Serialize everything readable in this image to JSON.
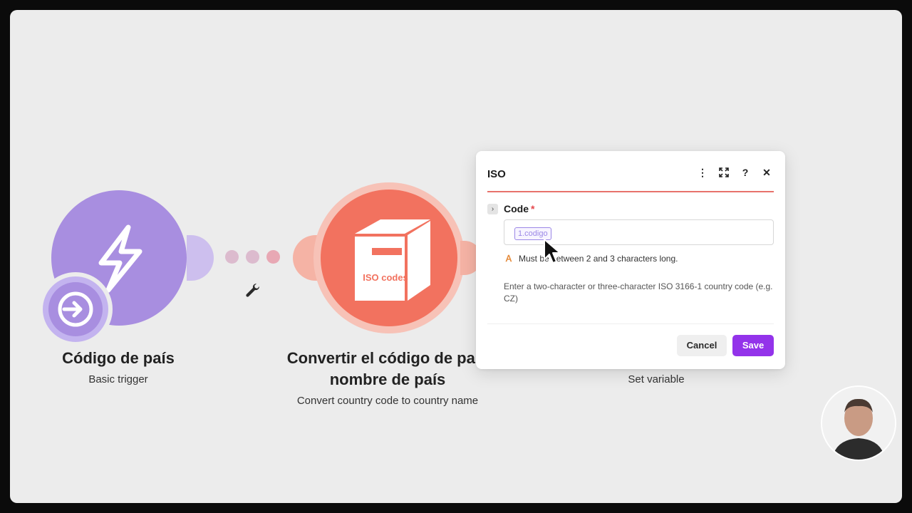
{
  "modules": {
    "trigger": {
      "title": "Código de país",
      "subtitle": "Basic trigger"
    },
    "iso": {
      "title_line1": "Convertir el código de país",
      "title_line2": "nombre de país",
      "subtitle": "Convert country code to country name",
      "box_label": "ISO codes"
    },
    "setvar": {
      "subtitle": "Set variable"
    }
  },
  "dialog": {
    "title": "ISO",
    "field_label": "Code",
    "required_mark": "*",
    "pill_value": "1.codigo",
    "warning": "Must be between 2 and 3 characters long.",
    "hint": "Enter a two-character or three-character ISO 3166-1 country code (e.g. CZ)",
    "cancel_label": "Cancel",
    "save_label": "Save",
    "tools": {
      "more": "⋮",
      "help": "?",
      "close": "✕"
    }
  },
  "colors": {
    "trigger": "#a88ee0",
    "iso": "#f2725f",
    "accent_rule": "#e8726b",
    "save_button": "#9333ea",
    "pill": "#9b87e6"
  }
}
